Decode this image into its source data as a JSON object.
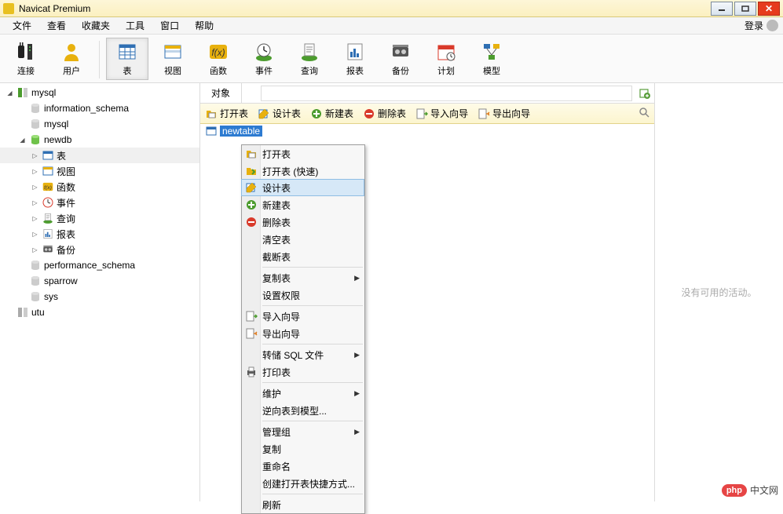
{
  "window": {
    "title": "Navicat Premium"
  },
  "menubar": {
    "items": [
      "文件",
      "查看",
      "收藏夹",
      "工具",
      "窗口",
      "帮助"
    ],
    "login": "登录"
  },
  "toolbar": {
    "buttons": [
      {
        "id": "connect",
        "label": "连接",
        "icon": "plug"
      },
      {
        "id": "user",
        "label": "用户",
        "icon": "user"
      },
      {
        "id": "table",
        "label": "表",
        "icon": "table",
        "active": true,
        "group": "new"
      },
      {
        "id": "view",
        "label": "视图",
        "icon": "view",
        "group": "same"
      },
      {
        "id": "function",
        "label": "函数",
        "icon": "fx",
        "group": "same"
      },
      {
        "id": "event",
        "label": "事件",
        "icon": "clock",
        "group": "same"
      },
      {
        "id": "query",
        "label": "查询",
        "icon": "query",
        "group": "same"
      },
      {
        "id": "report",
        "label": "报表",
        "icon": "report",
        "group": "same"
      },
      {
        "id": "backup",
        "label": "备份",
        "icon": "backup",
        "group": "same"
      },
      {
        "id": "schedule",
        "label": "计划",
        "icon": "calendar",
        "group": "same"
      },
      {
        "id": "model",
        "label": "模型",
        "icon": "model",
        "group": "same"
      }
    ]
  },
  "tree": [
    {
      "depth": 0,
      "exp": "open",
      "icon": "conn-green",
      "label": "mysql",
      "id": "conn-mysql"
    },
    {
      "depth": 1,
      "exp": "none",
      "icon": "db-grey",
      "label": "information_schema",
      "id": "db-information-schema"
    },
    {
      "depth": 1,
      "exp": "none",
      "icon": "db-grey",
      "label": "mysql",
      "id": "db-mysql"
    },
    {
      "depth": 1,
      "exp": "open",
      "icon": "db-green",
      "label": "newdb",
      "id": "db-newdb"
    },
    {
      "depth": 2,
      "exp": "close",
      "icon": "tables",
      "label": "表",
      "id": "node-tables",
      "selected": true
    },
    {
      "depth": 2,
      "exp": "close",
      "icon": "views",
      "label": "视图",
      "id": "node-views"
    },
    {
      "depth": 2,
      "exp": "close",
      "icon": "fx",
      "label": "函数",
      "id": "node-functions"
    },
    {
      "depth": 2,
      "exp": "close",
      "icon": "event",
      "label": "事件",
      "id": "node-events"
    },
    {
      "depth": 2,
      "exp": "close",
      "icon": "query",
      "label": "查询",
      "id": "node-queries"
    },
    {
      "depth": 2,
      "exp": "close",
      "icon": "report",
      "label": "报表",
      "id": "node-reports"
    },
    {
      "depth": 2,
      "exp": "close",
      "icon": "backup",
      "label": "备份",
      "id": "node-backups"
    },
    {
      "depth": 1,
      "exp": "none",
      "icon": "db-grey",
      "label": "performance_schema",
      "id": "db-performance-schema"
    },
    {
      "depth": 1,
      "exp": "none",
      "icon": "db-grey",
      "label": "sparrow",
      "id": "db-sparrow"
    },
    {
      "depth": 1,
      "exp": "none",
      "icon": "db-grey",
      "label": "sys",
      "id": "db-sys"
    },
    {
      "depth": 0,
      "exp": "none",
      "icon": "conn-grey",
      "label": "utu",
      "id": "conn-utu"
    }
  ],
  "content": {
    "tab": "对象",
    "actions": [
      {
        "id": "open-table",
        "label": "打开表",
        "icon": "open-yellow"
      },
      {
        "id": "design-table",
        "label": "设计表",
        "icon": "design"
      },
      {
        "id": "new-table",
        "label": "新建表",
        "icon": "plus-green"
      },
      {
        "id": "delete-table",
        "label": "删除表",
        "icon": "minus-red"
      },
      {
        "id": "import-wizard",
        "label": "导入向导",
        "icon": "import"
      },
      {
        "id": "export-wizard",
        "label": "导出向导",
        "icon": "export"
      }
    ],
    "list": [
      {
        "id": "newtable",
        "label": "newtable",
        "selected": true
      }
    ]
  },
  "context_menu": [
    {
      "label": "打开表",
      "icon": "open-yellow"
    },
    {
      "label": "打开表 (快速)",
      "icon": "open-fast"
    },
    {
      "label": "设计表",
      "icon": "design",
      "highlight": true
    },
    {
      "label": "新建表",
      "icon": "plus-green"
    },
    {
      "label": "删除表",
      "icon": "minus-red"
    },
    {
      "label": "清空表"
    },
    {
      "label": "截断表"
    },
    {
      "sep": true
    },
    {
      "label": "复制表",
      "submenu": true
    },
    {
      "label": "设置权限"
    },
    {
      "sep": true
    },
    {
      "label": "导入向导",
      "icon": "import"
    },
    {
      "label": "导出向导",
      "icon": "export"
    },
    {
      "sep": true
    },
    {
      "label": "转储 SQL 文件",
      "submenu": true
    },
    {
      "label": "打印表",
      "icon": "print"
    },
    {
      "sep": true
    },
    {
      "label": "维护",
      "submenu": true
    },
    {
      "label": "逆向表到模型..."
    },
    {
      "sep": true
    },
    {
      "label": "管理组",
      "submenu": true
    },
    {
      "label": "复制"
    },
    {
      "label": "重命名"
    },
    {
      "label": "创建打开表快捷方式..."
    },
    {
      "sep": true
    },
    {
      "label": "刷新"
    }
  ],
  "rightpanel": {
    "empty_text": "没有可用的活动。"
  },
  "watermark": {
    "tag": "php",
    "text": "中文网"
  }
}
